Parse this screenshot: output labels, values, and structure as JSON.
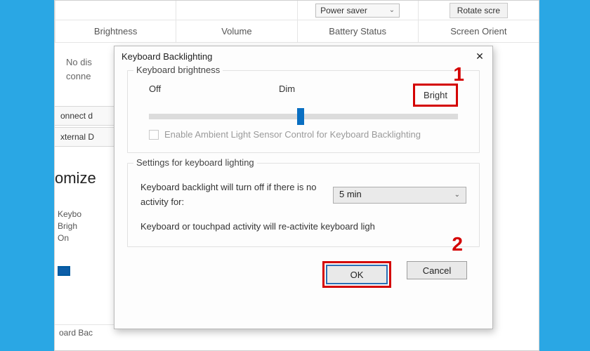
{
  "background": {
    "power_mode_selected": "Power saver",
    "rotate_btn": "Rotate scre",
    "labels": [
      "Brightness",
      "Volume",
      "Battery Status",
      "Screen Orient"
    ],
    "status_line1": "No dis",
    "status_line2": "conne",
    "side_items": [
      "onnect d",
      "xternal D"
    ],
    "customize_heading": "omize",
    "kb_line1": "Keybo",
    "kb_line2": "Brigh",
    "kb_line3": "On",
    "bottom_label": "oard Bac"
  },
  "dialog": {
    "title": "Keyboard Backlighting",
    "brightness_group": "Keyboard brightness",
    "slider_off": "Off",
    "slider_dim": "Dim",
    "slider_bright": "Bright",
    "ambient_checkbox": "Enable Ambient Light Sensor Control for Keyboard Backlighting",
    "settings_group": "Settings for keyboard lighting",
    "timeout_label": "Keyboard backlight will turn off if there is no activity for:",
    "timeout_value": "5 min",
    "reactivate_text": "Keyboard or touchpad activity will re-activite keyboard ligh",
    "ok": "OK",
    "cancel": "Cancel"
  },
  "callouts": {
    "one": "1",
    "two": "2"
  }
}
